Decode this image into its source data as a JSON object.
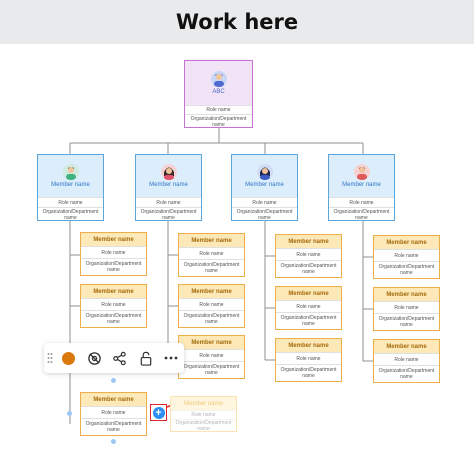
{
  "header": {
    "title": "Work here"
  },
  "root": {
    "name": "ABC",
    "role": "Role name",
    "org": "Organization/Department name"
  },
  "level1": [
    {
      "name": "Member name",
      "role": "Role name",
      "org": "Organization/Department name"
    },
    {
      "name": "Member name",
      "role": "Role name",
      "org": "Organization/Department name"
    },
    {
      "name": "Member name",
      "role": "Role name",
      "org": "Organization/Department name"
    },
    {
      "name": "Member name",
      "role": "Role name",
      "org": "Organization/Department name"
    }
  ],
  "level2_card": {
    "name": "Member name",
    "role": "Role name",
    "org": "Organization/Department name"
  },
  "ghost": {
    "name": "Member name",
    "role": "Role name",
    "org": "Organization/Department name"
  },
  "toolbar": {
    "items": [
      {
        "icon": "drag-handle-icon"
      },
      {
        "icon": "color-swatch-icon",
        "color": "#d9780c"
      },
      {
        "icon": "hide-icon"
      },
      {
        "icon": "share-icon"
      },
      {
        "icon": "lock-icon"
      },
      {
        "icon": "more-icon"
      }
    ]
  },
  "add_button": {
    "label": "+"
  },
  "colors": {
    "root_border": "#c773d3",
    "level1_border": "#5ba6df",
    "level2_border": "#f0ae49",
    "accent": "#2c8ef0",
    "highlight": "#e0262d"
  }
}
